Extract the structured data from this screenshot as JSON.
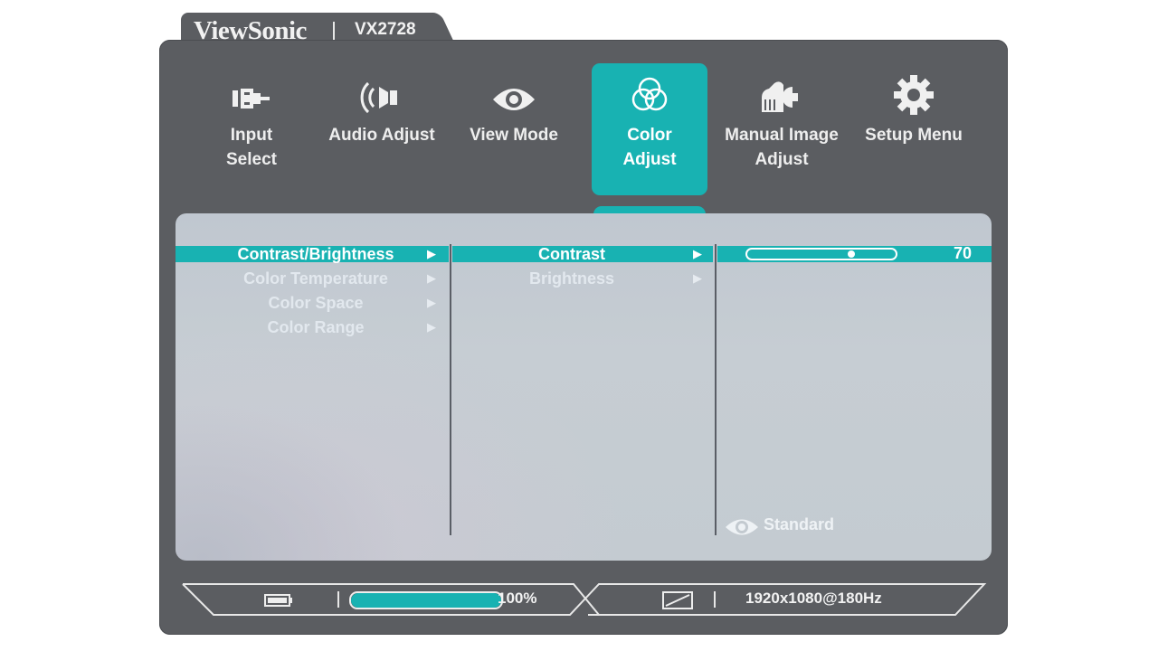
{
  "brand": {
    "name": "ViewSonic",
    "model": "VX2728"
  },
  "top_menu": [
    {
      "id": "input-select",
      "label_line1": "Input",
      "label_line2": "Select",
      "icon": "input-plug-icon",
      "active": false
    },
    {
      "id": "audio-adjust",
      "label_line1": "Audio Adjust",
      "label_line2": "",
      "icon": "speaker-icon",
      "active": false
    },
    {
      "id": "view-mode",
      "label_line1": "View Mode",
      "label_line2": "",
      "icon": "eye-icon",
      "active": false
    },
    {
      "id": "color-adjust",
      "label_line1": "Color",
      "label_line2": "Adjust",
      "icon": "color-circles-icon",
      "active": true
    },
    {
      "id": "manual-image-adjust",
      "label_line1": "Manual Image",
      "label_line2": "Adjust",
      "icon": "hand-wrench-icon",
      "active": false
    },
    {
      "id": "setup-menu",
      "label_line1": "Setup Menu",
      "label_line2": "",
      "icon": "gear-icon",
      "active": false
    }
  ],
  "submenu_level1": [
    "Contrast/Brightness",
    "Color Temperature",
    "Color Space",
    "Color Range"
  ],
  "submenu_level2": [
    "Contrast",
    "Brightness"
  ],
  "adjust": {
    "setting": "Contrast",
    "value": "70",
    "fraction": 0.7
  },
  "view_mode": {
    "label": "Standard",
    "icon": "eye-icon"
  },
  "status_bar": {
    "battery_icon": "battery-icon",
    "progress_fraction": 1.0,
    "progress_text": "100%",
    "aspect_icon": "aspect-ratio-icon",
    "resolution": "1920x1080@180Hz"
  },
  "colors": {
    "accent": "#18b2b2",
    "frame": "#5b5d61"
  }
}
